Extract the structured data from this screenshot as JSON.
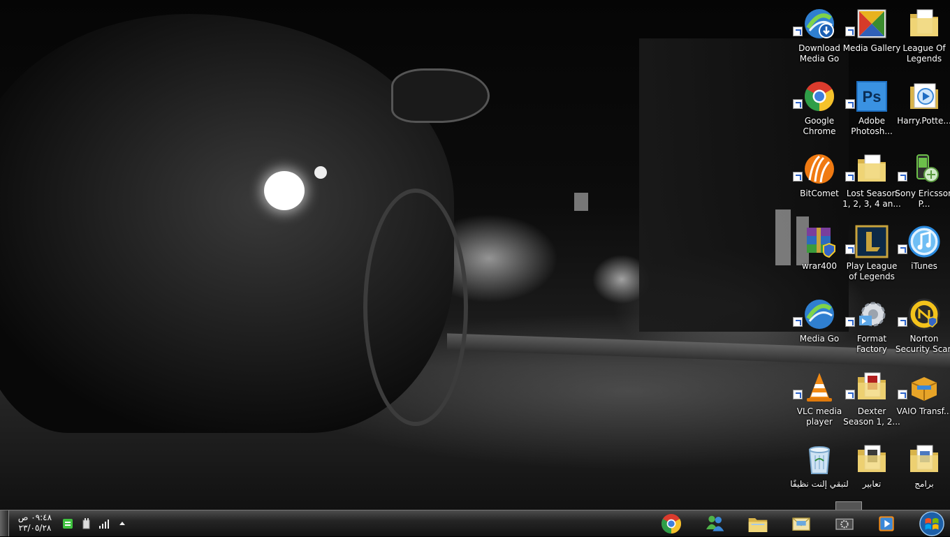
{
  "desktop": {
    "icons": [
      {
        "label": "Download Media Go",
        "icon": "media-go-download-icon",
        "shortcut": true
      },
      {
        "label": "Media Gallery",
        "icon": "media-gallery-icon",
        "shortcut": true
      },
      {
        "label": "League Of Legends",
        "icon": "folder-icon",
        "shortcut": false
      },
      {
        "label": "Google Chrome",
        "icon": "chrome-icon",
        "shortcut": true
      },
      {
        "label": "Adobe Photosh...",
        "icon": "photoshop-icon",
        "shortcut": true
      },
      {
        "label": "Harry.Potte...",
        "icon": "video-file-icon",
        "shortcut": false
      },
      {
        "label": "BitComet",
        "icon": "bitcomet-icon",
        "shortcut": true
      },
      {
        "label": "Lost Season 1, 2, 3, 4 an...",
        "icon": "folder-icon",
        "shortcut": true
      },
      {
        "label": "Sony Ericsson P...",
        "icon": "sony-ericsson-pc-suite-icon",
        "shortcut": true
      },
      {
        "label": "wrar400",
        "icon": "winrar-installer-icon",
        "shortcut": false
      },
      {
        "label": "Play League of Legends",
        "icon": "league-of-legends-icon",
        "shortcut": true
      },
      {
        "label": "iTunes",
        "icon": "itunes-icon",
        "shortcut": true
      },
      {
        "label": "Media Go",
        "icon": "media-go-icon",
        "shortcut": true
      },
      {
        "label": "Format Factory",
        "icon": "format-factory-icon",
        "shortcut": true
      },
      {
        "label": "Norton Security Scan",
        "icon": "norton-icon",
        "shortcut": true
      },
      {
        "label": "VLC media player",
        "icon": "vlc-icon",
        "shortcut": true
      },
      {
        "label": "Dexter Season 1, 2...",
        "icon": "folder-icon",
        "shortcut": true
      },
      {
        "label": "VAIO Transf...",
        "icon": "vaio-transfer-icon",
        "shortcut": true
      },
      {
        "label": "لتبقي إلنت نظيفًا",
        "icon": "recycle-bin-icon",
        "shortcut": false
      },
      {
        "label": "تعابير",
        "icon": "folder-icon",
        "shortcut": false
      },
      {
        "label": "برامج",
        "icon": "folder-icon",
        "shortcut": false
      }
    ]
  },
  "taskbar": {
    "clock": {
      "time": "٠٩:٤٨ ص",
      "date": "٢٣/٠٥/٢٨"
    },
    "tray_icons": [
      "network-signal-icon",
      "power-plug-icon",
      "green-app-icon"
    ],
    "show_hidden_icon": "chevron-up-icon",
    "pinned": [
      {
        "name": "chrome-taskbar-button",
        "icon": "chrome-icon"
      },
      {
        "name": "messenger-taskbar-button",
        "icon": "windows-live-messenger-icon"
      },
      {
        "name": "explorer-taskbar-button",
        "icon": "folder-icon"
      },
      {
        "name": "mail-taskbar-button",
        "icon": "mail-icon"
      },
      {
        "name": "device-taskbar-button",
        "icon": "device-settings-icon"
      },
      {
        "name": "media-player-taskbar-button",
        "icon": "media-player-icon"
      }
    ],
    "start": "windows-start-orb-icon"
  }
}
